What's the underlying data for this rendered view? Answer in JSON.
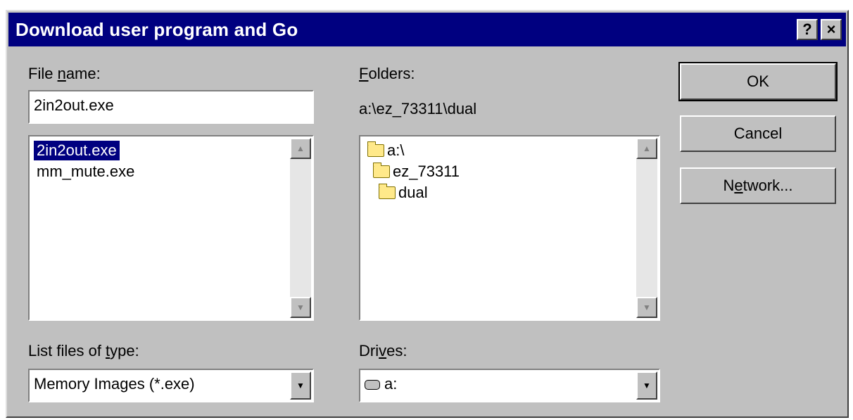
{
  "window": {
    "title": "Download user program and Go"
  },
  "titlebar": {
    "help": "?",
    "close": "×"
  },
  "file_name": {
    "label_pre": "File ",
    "label_mnemonic": "n",
    "label_post": "ame:",
    "value": "2in2out.exe",
    "files": [
      "2in2out.exe",
      "mm_mute.exe"
    ],
    "selected": "2in2out.exe"
  },
  "folders": {
    "label_mnemonic": "F",
    "label_post": "olders:",
    "current_path": "a:\\ez_73311\\dual",
    "items": [
      "a:\\",
      "ez_73311",
      "dual"
    ]
  },
  "file_type": {
    "label_pre": "List files of ",
    "label_mnemonic": "t",
    "label_post": "ype:",
    "value": "Memory Images  (*.exe)"
  },
  "drives": {
    "label_pre": "Dri",
    "label_mnemonic": "v",
    "label_post": "es:",
    "value": "a:"
  },
  "buttons": {
    "ok": "OK",
    "cancel": "Cancel",
    "network_pre": "N",
    "network_mnemonic": "e",
    "network_post": "twork..."
  }
}
